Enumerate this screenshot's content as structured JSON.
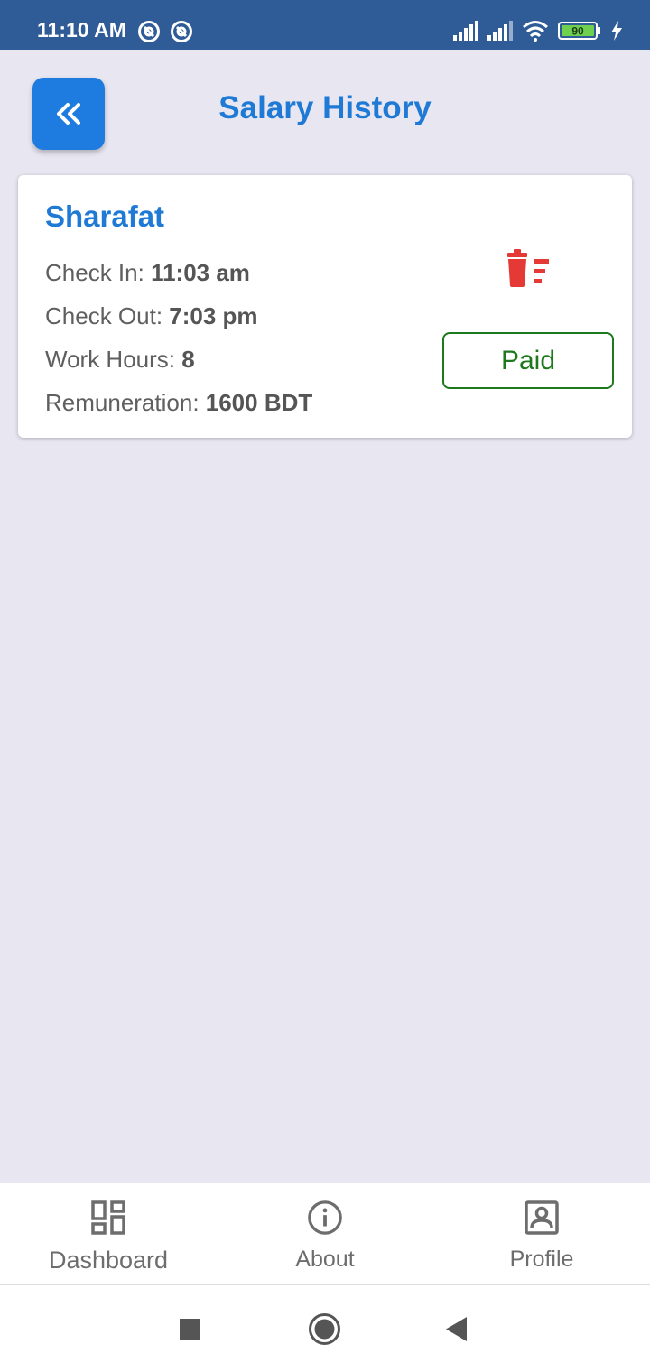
{
  "status_bar": {
    "time": "11:10 AM",
    "battery": "90"
  },
  "header": {
    "title": "Salary History",
    "back_icon": "double-chevron-left-icon"
  },
  "record": {
    "name": "Sharafat",
    "check_in_label": "Check In: ",
    "check_in_value": "11:03 am",
    "check_out_label": "Check Out: ",
    "check_out_value": "7:03 pm",
    "work_hours_label": "Work Hours: ",
    "work_hours_value": "8",
    "remuneration_label": "Remuneration: ",
    "remuneration_value": "1600 BDT",
    "status_button": "Paid",
    "delete_icon": "delete-sweep-icon"
  },
  "bottom_nav": {
    "items": [
      {
        "label": "Dashboard",
        "icon": "dashboard-icon"
      },
      {
        "label": "About",
        "icon": "info-icon"
      },
      {
        "label": "Profile",
        "icon": "profile-icon"
      }
    ]
  },
  "colors": {
    "accent": "#1f7ad6",
    "status_bar": "#2f5b97",
    "paid": "#1c7a1c",
    "delete": "#e53935",
    "background": "#e8e6f1"
  }
}
